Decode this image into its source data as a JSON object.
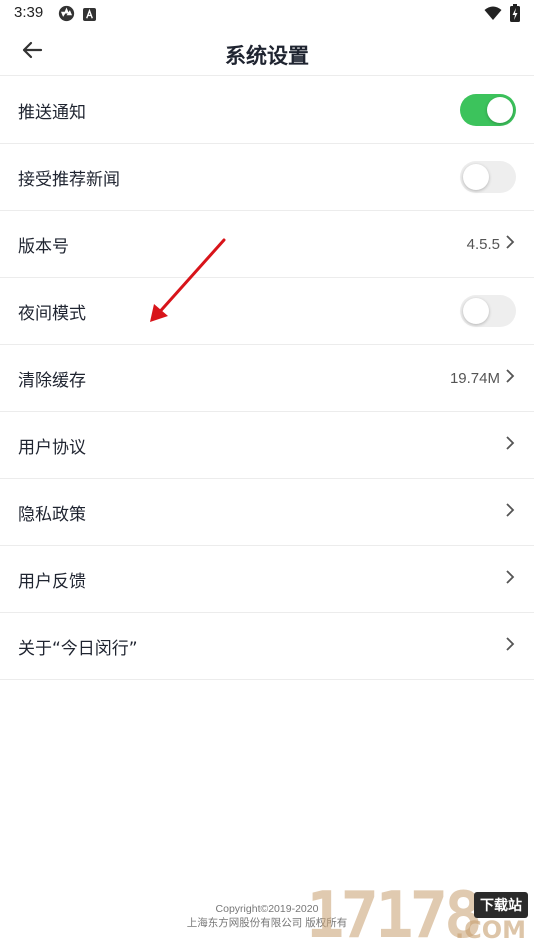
{
  "status_bar": {
    "time": "3:39",
    "icons_left": [
      "aperture-icon",
      "a-square-icon"
    ],
    "icons_right": [
      "wifi-icon",
      "battery-charging-icon"
    ]
  },
  "header": {
    "back_icon": "arrow-left-icon",
    "title": "系统设置"
  },
  "settings": {
    "items": [
      {
        "label": "推送通知",
        "control": "toggle",
        "on": true
      },
      {
        "label": "接受推荐新闻",
        "control": "toggle",
        "on": false
      },
      {
        "label": "版本号",
        "control": "value",
        "value": "4.5.5"
      },
      {
        "label": "夜间模式",
        "control": "toggle",
        "on": false
      },
      {
        "label": "清除缓存",
        "control": "value",
        "value": "19.74M"
      },
      {
        "label": "用户协议",
        "control": "chevron"
      },
      {
        "label": "隐私政策",
        "control": "chevron"
      },
      {
        "label": "用户反馈",
        "control": "chevron"
      },
      {
        "label": "关于“今日闵行”",
        "control": "chevron"
      }
    ]
  },
  "footer": {
    "copyright": "Copyright©2019-2020",
    "company": "上海东方网股份有限公司 版权所有"
  },
  "watermark": {
    "digits": "17178",
    "badge": "下载站",
    "domain": ".COM"
  },
  "colors": {
    "toggle_on": "#3cc35c",
    "toggle_off": "#eeeeee",
    "annotation_arrow": "#d8141a",
    "title_text": "#1f2430"
  }
}
